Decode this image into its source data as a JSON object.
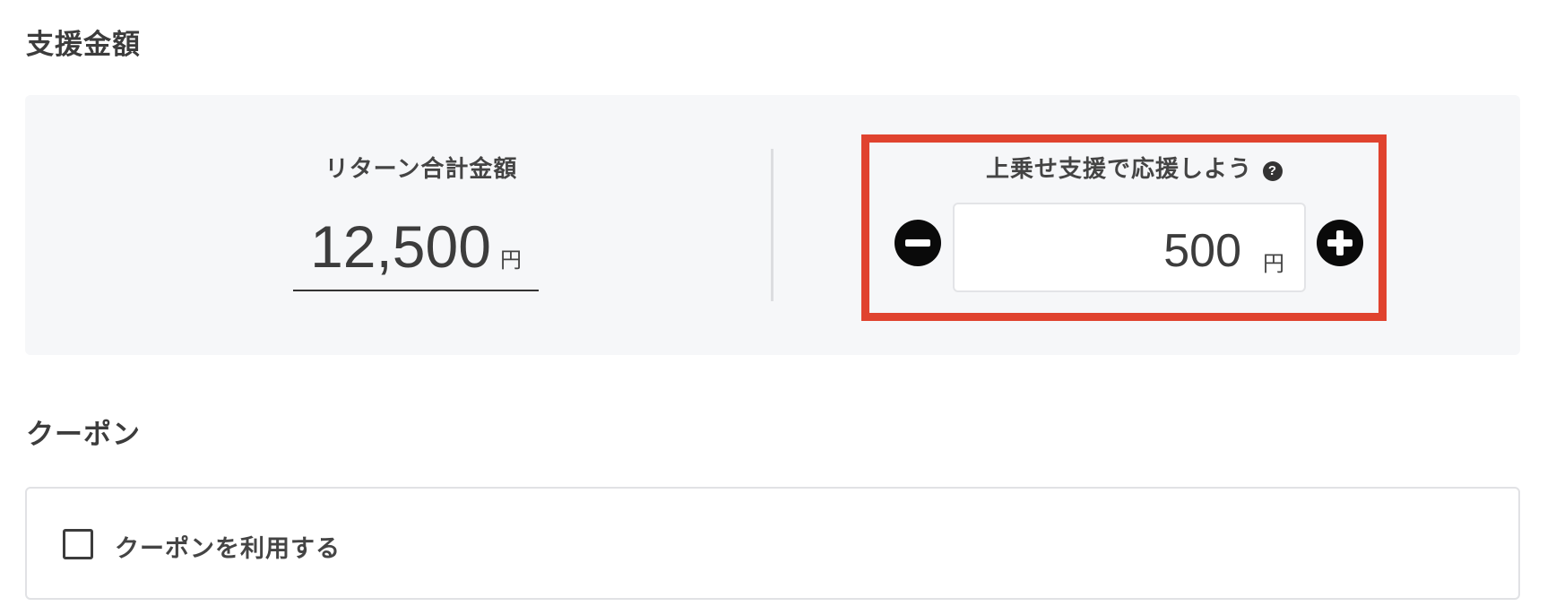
{
  "support": {
    "title": "支援金額",
    "return_label": "リターン合計金額",
    "return_amount": "12,500",
    "currency": "円",
    "addon_label": "上乗せ支援で応援しよう",
    "help_icon": "question-circle-icon",
    "addon_amount": "500",
    "minus_icon": "minus-circle-icon",
    "plus_icon": "plus-circle-icon",
    "highlight_color": "#e0432f"
  },
  "coupon": {
    "title": "クーポン",
    "checkbox_label": "クーポンを利用する",
    "checked": false
  }
}
